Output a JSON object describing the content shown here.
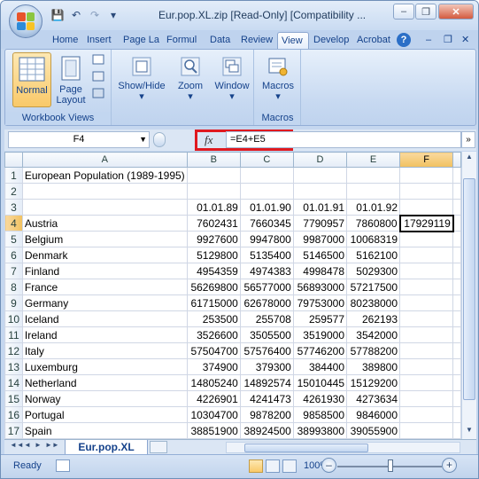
{
  "window": {
    "title": "Eur.pop.XL.zip  [Read-Only]  [Compatibility ...",
    "minimize": "–",
    "restore": "❐",
    "close": "✕"
  },
  "qat": {
    "save": "💾",
    "undo": "↶",
    "redo": "↷",
    "more": "▾"
  },
  "tabs": [
    "Home",
    "Insert",
    "Page La",
    "Formul",
    "Data",
    "Review",
    "View",
    "Develop",
    "Acrobat"
  ],
  "active_tab": "View",
  "help_icon": "?",
  "ribbon": {
    "workbook_views": {
      "label": "Workbook Views",
      "normal": "Normal",
      "page_layout": "Page Layout"
    },
    "show_hide": "Show/Hide",
    "zoom": "Zoom",
    "window": "Window",
    "macros": {
      "button": "Macros",
      "label": "Macros"
    }
  },
  "formula_bar": {
    "name_box": "F4",
    "fx": "fx",
    "formula": "=E4+E5"
  },
  "columns": [
    "A",
    "B",
    "C",
    "D",
    "E",
    "F"
  ],
  "selected_column": "F",
  "rows": [
    {
      "n": "1",
      "a": "European Population (1989-1995)",
      "b": "",
      "c": "",
      "d": "",
      "e": "",
      "f": ""
    },
    {
      "n": "2",
      "a": "",
      "b": "",
      "c": "",
      "d": "",
      "e": "",
      "f": ""
    },
    {
      "n": "3",
      "a": "",
      "b": "01.01.89",
      "c": "01.01.90",
      "d": "01.01.91",
      "e": "01.01.92",
      "f": ""
    },
    {
      "n": "4",
      "a": "Austria",
      "b": "7602431",
      "c": "7660345",
      "d": "7790957",
      "e": "7860800",
      "f": "17929119"
    },
    {
      "n": "5",
      "a": "Belgium",
      "b": "9927600",
      "c": "9947800",
      "d": "9987000",
      "e": "10068319",
      "f": ""
    },
    {
      "n": "6",
      "a": "Denmark",
      "b": "5129800",
      "c": "5135400",
      "d": "5146500",
      "e": "5162100",
      "f": ""
    },
    {
      "n": "7",
      "a": "Finland",
      "b": "4954359",
      "c": "4974383",
      "d": "4998478",
      "e": "5029300",
      "f": ""
    },
    {
      "n": "8",
      "a": "France",
      "b": "56269800",
      "c": "56577000",
      "d": "56893000",
      "e": "57217500",
      "f": ""
    },
    {
      "n": "9",
      "a": "Germany",
      "b": "61715000",
      "c": "62678000",
      "d": "79753000",
      "e": "80238000",
      "f": ""
    },
    {
      "n": "10",
      "a": "Iceland",
      "b": "253500",
      "c": "255708",
      "d": "259577",
      "e": "262193",
      "f": ""
    },
    {
      "n": "11",
      "a": "Ireland",
      "b": "3526600",
      "c": "3505500",
      "d": "3519000",
      "e": "3542000",
      "f": ""
    },
    {
      "n": "12",
      "a": "Italy",
      "b": "57504700",
      "c": "57576400",
      "d": "57746200",
      "e": "57788200",
      "f": ""
    },
    {
      "n": "13",
      "a": "Luxemburg",
      "b": "374900",
      "c": "379300",
      "d": "384400",
      "e": "389800",
      "f": ""
    },
    {
      "n": "14",
      "a": "Netherland",
      "b": "14805240",
      "c": "14892574",
      "d": "15010445",
      "e": "15129200",
      "f": ""
    },
    {
      "n": "15",
      "a": "Norway",
      "b": "4226901",
      "c": "4241473",
      "d": "4261930",
      "e": "4273634",
      "f": ""
    },
    {
      "n": "16",
      "a": "Portugal",
      "b": "10304700",
      "c": "9878200",
      "d": "9858500",
      "e": "9846000",
      "f": ""
    },
    {
      "n": "17",
      "a": "Spain",
      "b": "38851900",
      "c": "38924500",
      "d": "38993800",
      "e": "39055900",
      "f": ""
    }
  ],
  "active_row": "4",
  "sheet_tab": "Eur.pop.XL",
  "sheet_nav": [
    "◄◄",
    "◄",
    "►",
    "►►"
  ],
  "status": {
    "ready": "Ready",
    "zoom": "100%",
    "zoom_minus": "–",
    "zoom_plus": "+"
  }
}
